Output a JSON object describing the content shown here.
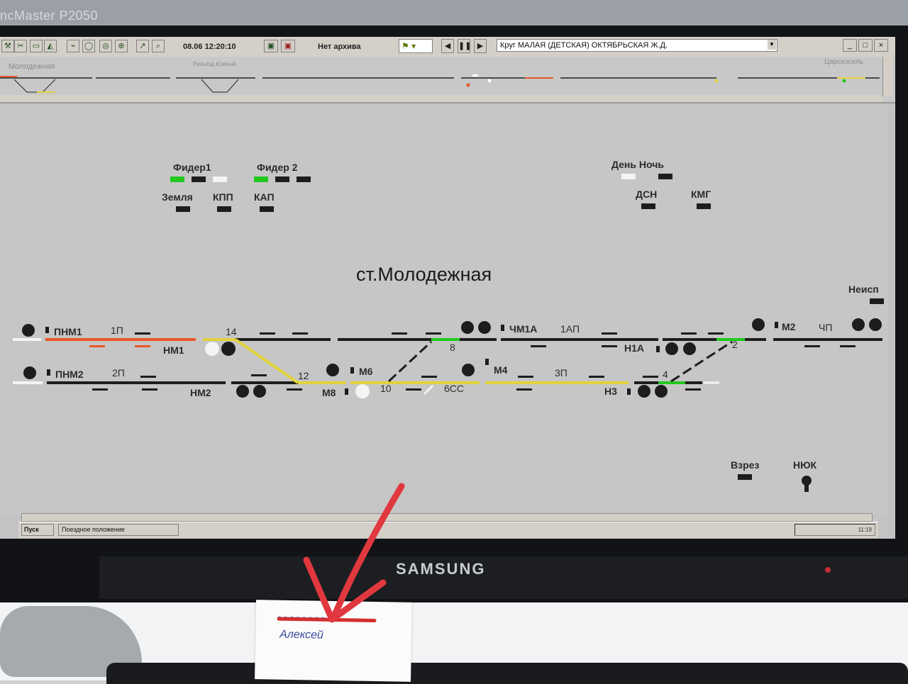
{
  "environment": {
    "wall_label": "ncMaster P2050",
    "brand": "SAMSUNG",
    "note_name": "Алексей"
  },
  "toolbar": {
    "buttons": [
      "tools",
      "scissors",
      "monitor",
      "chart",
      "link",
      "ellipse",
      "ring",
      "globe",
      "pointer",
      "zoom"
    ],
    "time": "08.06 12:20:10",
    "archive_status": "Нет архива",
    "nav": [
      "◀",
      "❚❚",
      "▶"
    ],
    "circuit_select": "Круг МАЛАЯ (ДЕТСКАЯ) ОКТЯБРЬСКАЯ Ж.Д.",
    "window_buttons": [
      "_",
      "□",
      "×"
    ]
  },
  "overview": {
    "left_station": "Молодежная",
    "mid_label": "Разъезд Южный",
    "right_station": "Царскосель"
  },
  "station": {
    "title": "ст.Молодежная",
    "feeders": {
      "feeder1": "Фидер1",
      "feeder2": "Фидер 2",
      "ground": "Земля",
      "kpp": "КПП",
      "kap": "КАП"
    },
    "day_night": "День Ночь",
    "dsn": "ДСН",
    "kmg": "КМГ",
    "neisp": "Неисп",
    "vzrez": "Взрез",
    "nyuk": "НЮК",
    "signals": {
      "pnm1": "ПНМ1",
      "pnm2": "ПНМ2",
      "nm1": "НМ1",
      "nm2": "НМ2",
      "m6": "М6",
      "m8": "М8",
      "m4": "М4",
      "chm1a": "ЧМ1А",
      "n1a": "Н1А",
      "m2": "М2",
      "n3": "Н3"
    },
    "tracks": {
      "t1p": "1П",
      "t2p": "2П",
      "t1ap": "1АП",
      "t3p": "3П",
      "tchp": "ЧП",
      "t6ss": "6СС"
    },
    "switches": [
      "14",
      "12",
      "10",
      "8",
      "4",
      "2"
    ]
  },
  "taskbar": {
    "start": "Пуск",
    "window": "Поездное положение",
    "clock": "11:19"
  },
  "colors": {
    "route_yellow": "#e2d23a",
    "occupied_red": "#e8572a",
    "free_green": "#22c81e",
    "track_black": "#1d1d1d",
    "screen_bg": "#c6c6c6"
  }
}
